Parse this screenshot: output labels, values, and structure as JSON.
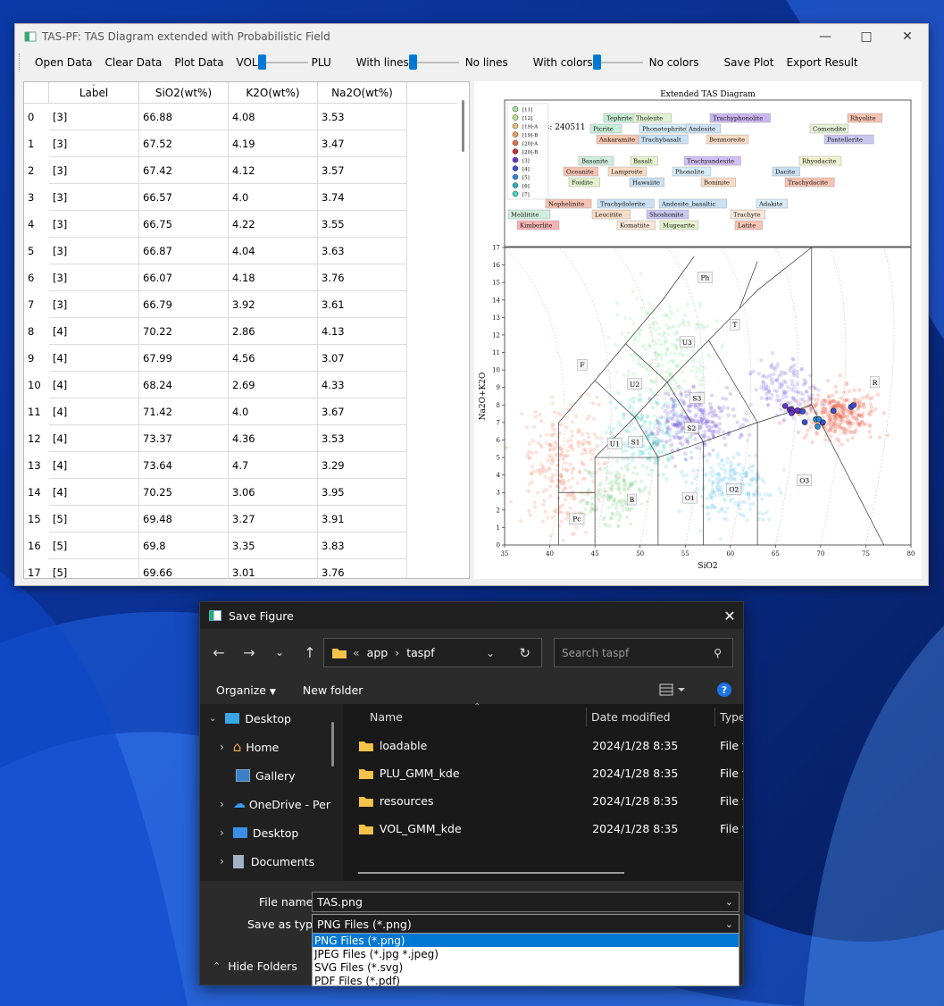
{
  "main_window": {
    "title": "TAS-PF: TAS Diagram extended with Probabilistic Field",
    "toolbar": {
      "open_data": "Open Data",
      "clear_data": "Clear Data",
      "plot_data": "Plot Data",
      "vol": "VOL",
      "plu": "PLU",
      "with_lines": "With lines",
      "no_lines": "No lines",
      "with_colors": "With colors",
      "no_colors": "No colors",
      "save_plot": "Save Plot",
      "export_result": "Export Result"
    },
    "table": {
      "headers": [
        "Label",
        "SiO2(wt%)",
        "K2O(wt%)",
        "Na2O(wt%)"
      ],
      "rows": [
        [
          "0",
          "[3]",
          "66.88",
          "4.08",
          "3.53"
        ],
        [
          "1",
          "[3]",
          "67.52",
          "4.19",
          "3.47"
        ],
        [
          "2",
          "[3]",
          "67.42",
          "4.12",
          "3.57"
        ],
        [
          "3",
          "[3]",
          "66.57",
          "4.0",
          "3.74"
        ],
        [
          "4",
          "[3]",
          "66.75",
          "4.22",
          "3.55"
        ],
        [
          "5",
          "[3]",
          "66.87",
          "4.04",
          "3.63"
        ],
        [
          "6",
          "[3]",
          "66.07",
          "4.18",
          "3.76"
        ],
        [
          "7",
          "[3]",
          "66.79",
          "3.92",
          "3.61"
        ],
        [
          "8",
          "[4]",
          "70.22",
          "2.86",
          "4.13"
        ],
        [
          "9",
          "[4]",
          "67.99",
          "4.56",
          "3.07"
        ],
        [
          "10",
          "[4]",
          "68.24",
          "2.69",
          "4.33"
        ],
        [
          "11",
          "[4]",
          "71.42",
          "4.0",
          "3.67"
        ],
        [
          "12",
          "[4]",
          "73.37",
          "4.36",
          "3.53"
        ],
        [
          "13",
          "[4]",
          "73.64",
          "4.7",
          "3.29"
        ],
        [
          "14",
          "[4]",
          "70.25",
          "3.06",
          "3.95"
        ],
        [
          "15",
          "[5]",
          "69.48",
          "3.27",
          "3.91"
        ],
        [
          "16",
          "[5]",
          "69.8",
          "3.35",
          "3.83"
        ],
        [
          "17",
          "[5]",
          "69.66",
          "3.01",
          "3.76"
        ]
      ]
    }
  },
  "chart_data": {
    "type": "scatter",
    "title": "Extended TAS Diagram",
    "xlabel": "SiO2",
    "ylabel": "Na2O+K2O",
    "xlim": [
      35,
      80
    ],
    "ylim": [
      0,
      17
    ],
    "xticks": [
      35,
      40,
      45,
      50,
      55,
      60,
      65,
      70,
      75,
      80
    ],
    "yticks": [
      0,
      1,
      2,
      3,
      4,
      5,
      6,
      7,
      8,
      9,
      10,
      11,
      12,
      13,
      14,
      15,
      16,
      17
    ],
    "points_text": "oints: 240511",
    "legend_entries": [
      "[11]",
      "[12]",
      "[19]-A",
      "[19]-B",
      "[20]-A",
      "[20]-B",
      "[3]",
      "[4]",
      "[5]",
      "[6]",
      "[7]"
    ],
    "legend_colors": [
      "#9de3a8",
      "#b8e08e",
      "#e8c07a",
      "#e3a060",
      "#e06f4a",
      "#c83030",
      "#6a2fd0",
      "#3a4fd8",
      "#2a8ad8",
      "#2ab0c8",
      "#3ed8c0"
    ],
    "field_codes": [
      "Ph",
      "T",
      "U3",
      "F",
      "U2",
      "S3",
      "S2",
      "R",
      "U1",
      "S1",
      "O1",
      "O2",
      "O3",
      "B",
      "Pc"
    ],
    "rock_names": [
      {
        "name": "Tephrite",
        "color": "#c8efd8"
      },
      {
        "name": "Tholeiite",
        "color": "#e0f2d2"
      },
      {
        "name": "Trachyphonolite",
        "color": "#c9b6f0"
      },
      {
        "name": "Rhyolite",
        "color": "#f6c3b3"
      },
      {
        "name": "Picrite",
        "color": "#c8efd8"
      },
      {
        "name": "Phonotephrite",
        "color": "#d6ecf6"
      },
      {
        "name": "Andesite",
        "color": "#cfe3f6"
      },
      {
        "name": "Comendite",
        "color": "#e4f2d6"
      },
      {
        "name": "Ankaramite",
        "color": "#f6c7b0"
      },
      {
        "name": "Trachybasalt",
        "color": "#c9e1f3"
      },
      {
        "name": "Benmoreite",
        "color": "#f8dcc6"
      },
      {
        "name": "Pantellerite",
        "color": "#c9c6f0"
      },
      {
        "name": "Basanite",
        "color": "#d0eedd"
      },
      {
        "name": "Basalt",
        "color": "#e4f3cc"
      },
      {
        "name": "Trachyandesite",
        "color": "#d2bff3"
      },
      {
        "name": "Rhyodacite",
        "color": "#eef2cf"
      },
      {
        "name": "Oceanite",
        "color": "#f6c3b3"
      },
      {
        "name": "Lamproite",
        "color": "#f8dcc6"
      },
      {
        "name": "Phonolite",
        "color": "#d6ecf6"
      },
      {
        "name": "Dacite",
        "color": "#c9e1f3"
      },
      {
        "name": "Foidite",
        "color": "#e4f3cc"
      },
      {
        "name": "Hawaiite",
        "color": "#c9e1f3"
      },
      {
        "name": "Boninite",
        "color": "#f8dcc6"
      },
      {
        "name": "Trachydacite",
        "color": "#f6c3b3"
      },
      {
        "name": "Nephelinite",
        "color": "#f6c3b3"
      },
      {
        "name": "Trachydolerite",
        "color": "#c9e1f3"
      },
      {
        "name": "Andesite_basaltic",
        "color": "#c9e1f3"
      },
      {
        "name": "Adakite",
        "color": "#d6ecf6"
      },
      {
        "name": "Melilitite",
        "color": "#d0eedd"
      },
      {
        "name": "Leucitite",
        "color": "#f8dcc6"
      },
      {
        "name": "Shoshonite",
        "color": "#c9c6f0"
      },
      {
        "name": "Trachyte",
        "color": "#f8e6d6"
      },
      {
        "name": "Kimberlite",
        "color": "#f6b3b3"
      },
      {
        "name": "Komatiite",
        "color": "#f8e6d6"
      },
      {
        "name": "Mugearite",
        "color": "#e4f3cc"
      },
      {
        "name": "Latite",
        "color": "#f6c3b3"
      }
    ],
    "series": [
      {
        "name": "[3]",
        "values": [
          [
            66.88,
            7.61
          ],
          [
            67.52,
            7.66
          ],
          [
            67.42,
            7.69
          ],
          [
            66.57,
            7.74
          ],
          [
            66.75,
            7.77
          ],
          [
            66.87,
            7.67
          ],
          [
            66.07,
            7.94
          ],
          [
            66.79,
            7.53
          ]
        ]
      },
      {
        "name": "[4]",
        "values": [
          [
            70.22,
            6.99
          ],
          [
            67.99,
            7.63
          ],
          [
            68.24,
            7.02
          ],
          [
            71.42,
            7.67
          ],
          [
            73.37,
            7.89
          ],
          [
            73.64,
            7.99
          ],
          [
            70.25,
            7.01
          ]
        ]
      },
      {
        "name": "[5]",
        "values": [
          [
            69.48,
            7.18
          ],
          [
            69.8,
            7.18
          ],
          [
            69.66,
            6.77
          ]
        ]
      }
    ]
  },
  "save_dialog": {
    "title": "Save Figure",
    "breadcrumb": [
      "app",
      "taspf"
    ],
    "search_placeholder": "Search taspf",
    "organize": "Organize",
    "new_folder": "New folder",
    "nav_items": [
      "Desktop",
      "Home",
      "Gallery",
      "OneDrive - Per",
      "Desktop",
      "Documents"
    ],
    "columns": {
      "name": "Name",
      "date": "Date modified",
      "type": "Type"
    },
    "files": [
      {
        "name": "loadable",
        "date": "2024/1/28 8:35",
        "type": "File fo"
      },
      {
        "name": "PLU_GMM_kde",
        "date": "2024/1/28 8:35",
        "type": "File fo"
      },
      {
        "name": "resources",
        "date": "2024/1/28 8:35",
        "type": "File fo"
      },
      {
        "name": "VOL_GMM_kde",
        "date": "2024/1/28 8:35",
        "type": "File fo"
      }
    ],
    "file_name_label": "File name:",
    "file_name_value": "TAS.png",
    "save_as_type_label": "Save as type:",
    "save_as_type_value": "PNG Files (*.png)",
    "type_options": [
      "PNG Files (*.png)",
      "JPEG Files (*.jpg *.jpeg)",
      "SVG Files (*.svg)",
      "PDF Files (*.pdf)"
    ],
    "hide_folders": "Hide Folders"
  }
}
